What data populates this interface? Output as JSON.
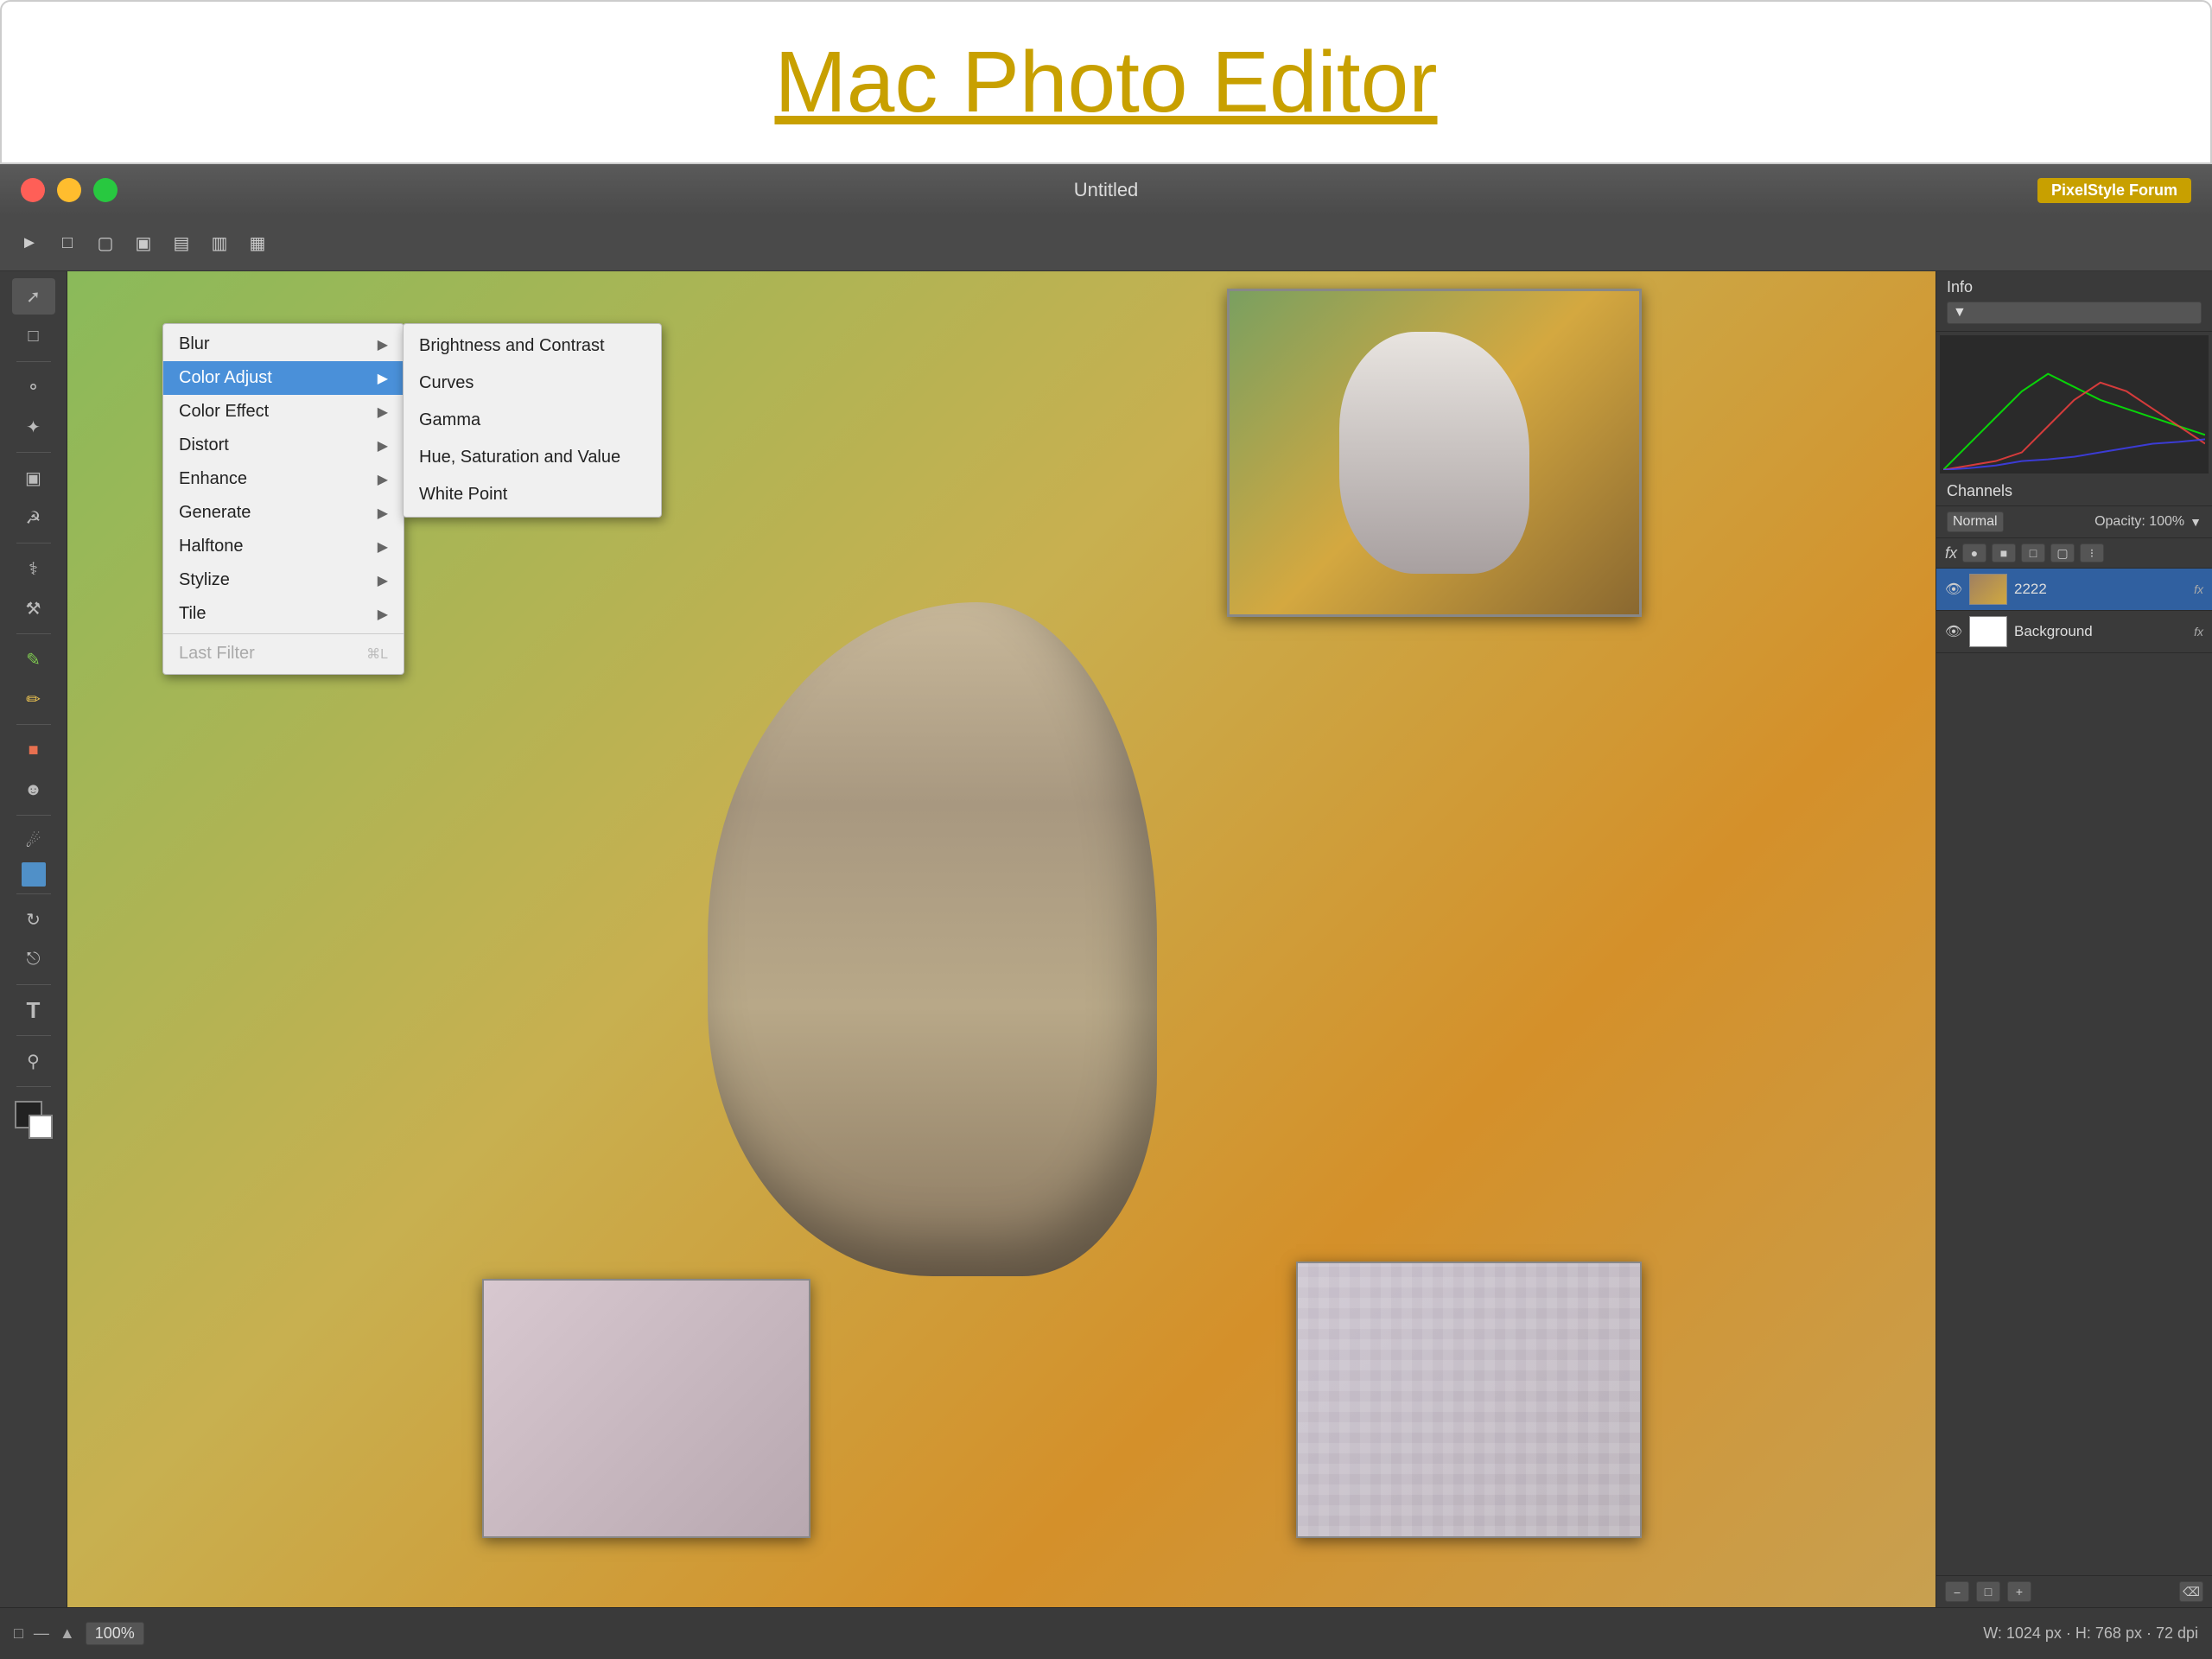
{
  "page": {
    "title": "Mac Photo Editor",
    "title_link": "#"
  },
  "window": {
    "title": "Untitled",
    "badge": "PixelStyle Forum",
    "traffic_lights": [
      "red",
      "yellow",
      "green"
    ]
  },
  "toolbar": {
    "icons": [
      "arrow-tool",
      "new-doc",
      "open-doc",
      "duplicate-doc",
      "save-doc",
      "export-doc",
      "share-doc"
    ]
  },
  "tools": [
    "move-tool",
    "selection-tool",
    "lasso-tool",
    "magic-wand",
    "crop-tool",
    "measure-tool",
    "eyedropper-tool",
    "heal-tool",
    "brush-tool",
    "eraser-tool",
    "paint-bucket",
    "gradient-tool",
    "pen-tool",
    "shape-tool",
    "text-tool",
    "zoom-tool",
    "hand-tool",
    "transform-tool"
  ],
  "filter_menu": {
    "items": [
      {
        "label": "Blur",
        "has_arrow": true,
        "selected": false,
        "disabled": false
      },
      {
        "label": "Color Adjust",
        "has_arrow": true,
        "selected": true,
        "disabled": false
      },
      {
        "label": "Color Effect",
        "has_arrow": true,
        "selected": false,
        "disabled": false
      },
      {
        "label": "Distort",
        "has_arrow": true,
        "selected": false,
        "disabled": false
      },
      {
        "label": "Enhance",
        "has_arrow": true,
        "selected": false,
        "disabled": false
      },
      {
        "label": "Generate",
        "has_arrow": true,
        "selected": false,
        "disabled": false
      },
      {
        "label": "Halftone",
        "has_arrow": true,
        "selected": false,
        "disabled": false
      },
      {
        "label": "Stylize",
        "has_arrow": true,
        "selected": false,
        "disabled": false
      },
      {
        "label": "Tile",
        "has_arrow": true,
        "selected": false,
        "disabled": false
      }
    ],
    "separator": true,
    "last_filter": {
      "label": "Last Filter",
      "shortcut": "⌘L",
      "disabled": true
    }
  },
  "submenu": {
    "items": [
      "Brightness and Contrast",
      "Curves",
      "Gamma",
      "Hue, Saturation and Value",
      "White Point"
    ]
  },
  "right_panel": {
    "info_label": "Info",
    "channels_label": "Channels",
    "blend_mode": "Normal",
    "opacity": "Opacity: 100%",
    "fx_label": "fx",
    "layers": [
      {
        "name": "2222",
        "visible": true,
        "active": true,
        "has_fx": true
      },
      {
        "name": "Background",
        "visible": true,
        "active": false,
        "has_fx": true
      }
    ]
  },
  "status_bar": {
    "zoom": "100%",
    "dimensions": "W: 1024 px  ·  H: 768 px  ·  72 dpi"
  }
}
